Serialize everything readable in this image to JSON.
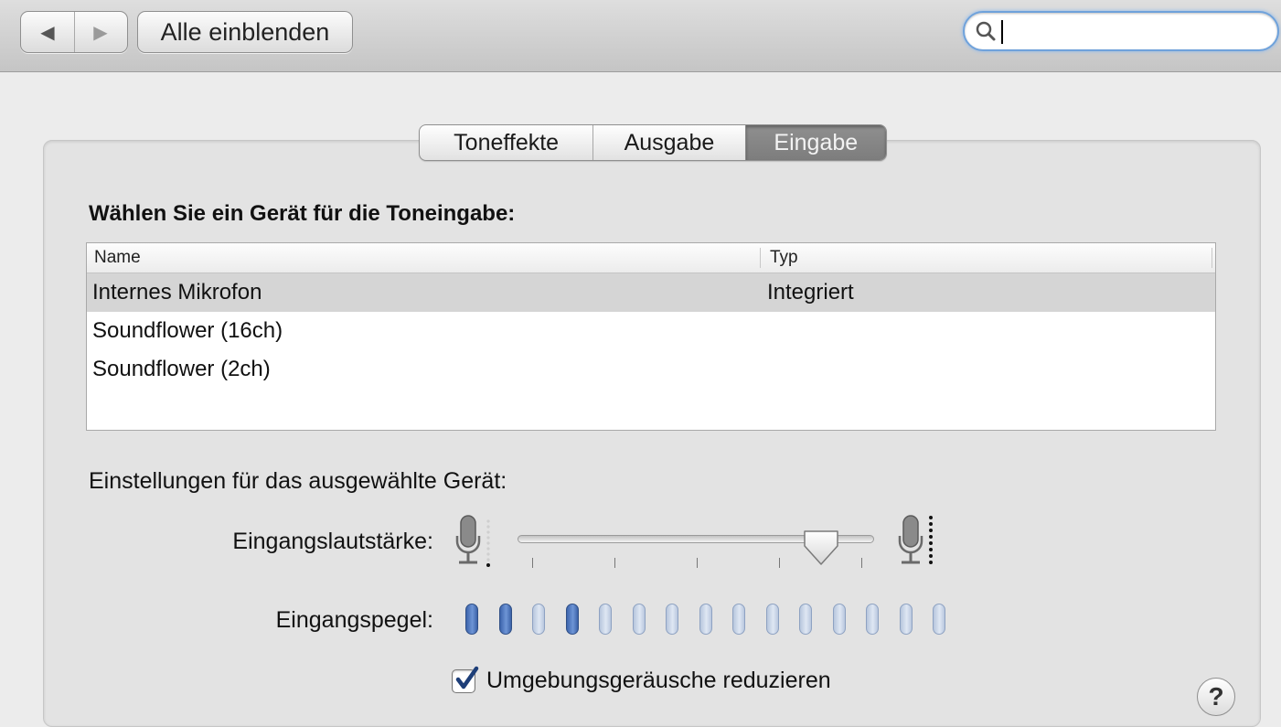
{
  "toolbar": {
    "back_glyph": "◀",
    "forward_glyph": "▶",
    "show_all_label": "Alle einblenden",
    "search_value": ""
  },
  "tabs": [
    {
      "label": "Toneffekte",
      "selected": false
    },
    {
      "label": "Ausgabe",
      "selected": false
    },
    {
      "label": "Eingabe",
      "selected": true
    }
  ],
  "device_section": {
    "title": "Wählen Sie ein Gerät für die Toneingabe:",
    "columns": [
      "Name",
      "Typ"
    ],
    "rows": [
      {
        "name": "Internes Mikrofon",
        "type": "Integriert",
        "selected": true
      },
      {
        "name": "Soundflower (16ch)",
        "type": "",
        "selected": false
      },
      {
        "name": "Soundflower (2ch)",
        "type": "",
        "selected": false
      }
    ]
  },
  "settings": {
    "title": "Einstellungen für das ausgewählte Gerät:",
    "input_volume_label": "Eingangslautstärke:",
    "input_volume_fraction": 0.87,
    "input_level_label": "Eingangspegel:",
    "input_level_bars_total": 15,
    "input_level_bars_active": [
      1,
      2,
      4
    ],
    "noise_reduction_label": "Umgebungsgeräusche reduzieren",
    "noise_reduction_checked": true
  },
  "help_label": "?",
  "colors": {
    "accent_focus": "#6fa2db",
    "level_active": "#3d65ad",
    "level_inactive": "#c9d5e8",
    "selected_row": "#d5d5d5"
  },
  "icons": [
    "back-arrow-icon",
    "forward-arrow-icon",
    "search-icon",
    "microphone-low-icon",
    "microphone-high-icon",
    "checkmark-icon",
    "help-icon"
  ]
}
